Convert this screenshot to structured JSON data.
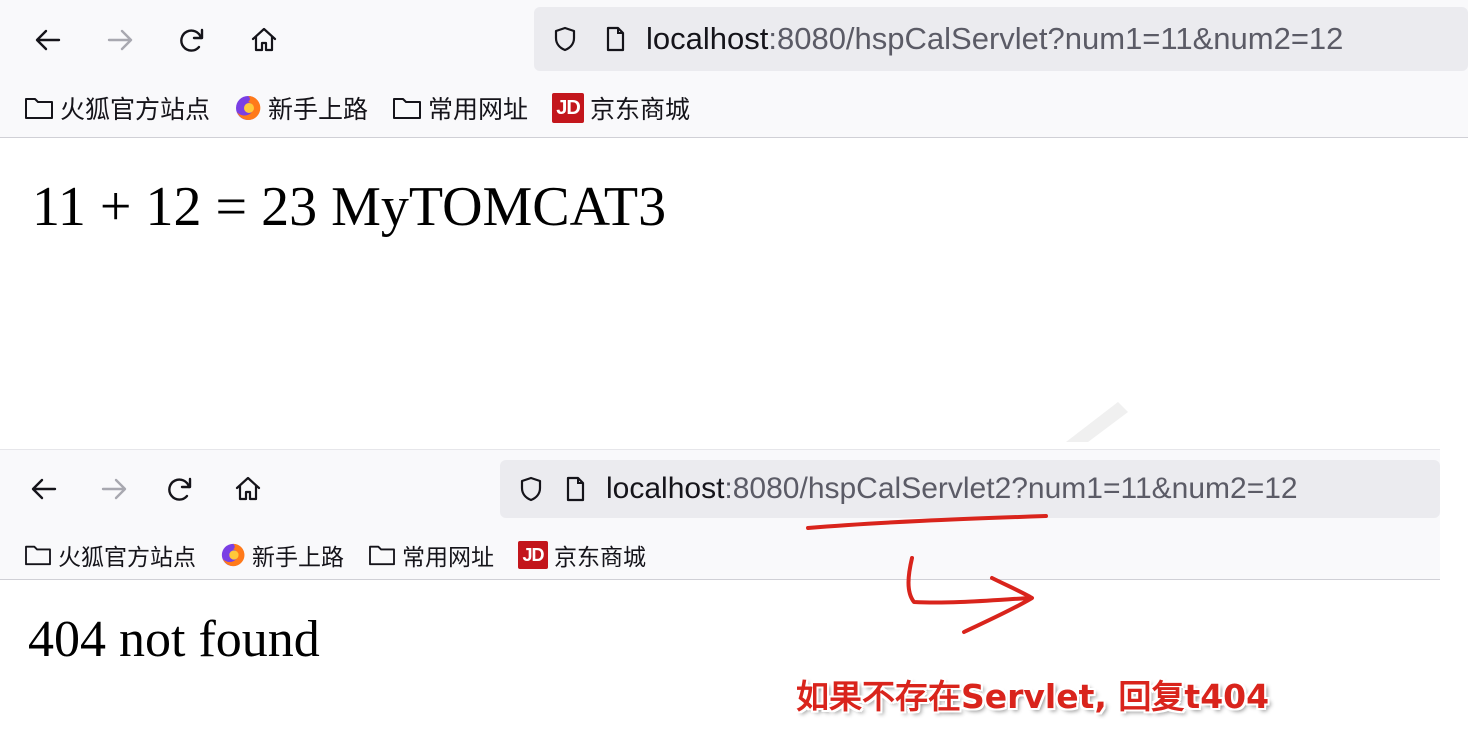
{
  "browser_top": {
    "url": {
      "host": "localhost",
      "rest": ":8080/hspCalServlet?num1=11&num2=12"
    },
    "bookmarks": [
      {
        "icon": "folder-icon",
        "label": "火狐官方站点"
      },
      {
        "icon": "firefox-icon",
        "label": "新手上路"
      },
      {
        "icon": "folder-icon",
        "label": "常用网址"
      },
      {
        "icon": "jd-icon",
        "label": "京东商城",
        "badge": "JD"
      }
    ],
    "content": "11 + 12 = 23 MyTOMCAT3"
  },
  "browser_bottom": {
    "url": {
      "host": "localhost",
      "rest": ":8080/hspCalServlet2?num1=11&num2=12"
    },
    "bookmarks": [
      {
        "icon": "folder-icon",
        "label": "火狐官方站点"
      },
      {
        "icon": "firefox-icon",
        "label": "新手上路"
      },
      {
        "icon": "folder-icon",
        "label": "常用网址"
      },
      {
        "icon": "jd-icon",
        "label": "京东商城",
        "badge": "JD"
      }
    ],
    "content": "404 not found"
  },
  "annotation": {
    "text": "如果不存在Servlet, 回复t404",
    "color": "#d9241c"
  },
  "colors": {
    "toolbar_bg": "#f9f9fb",
    "urlbar_bg": "#ebebef",
    "jd_red": "#c3161c"
  }
}
